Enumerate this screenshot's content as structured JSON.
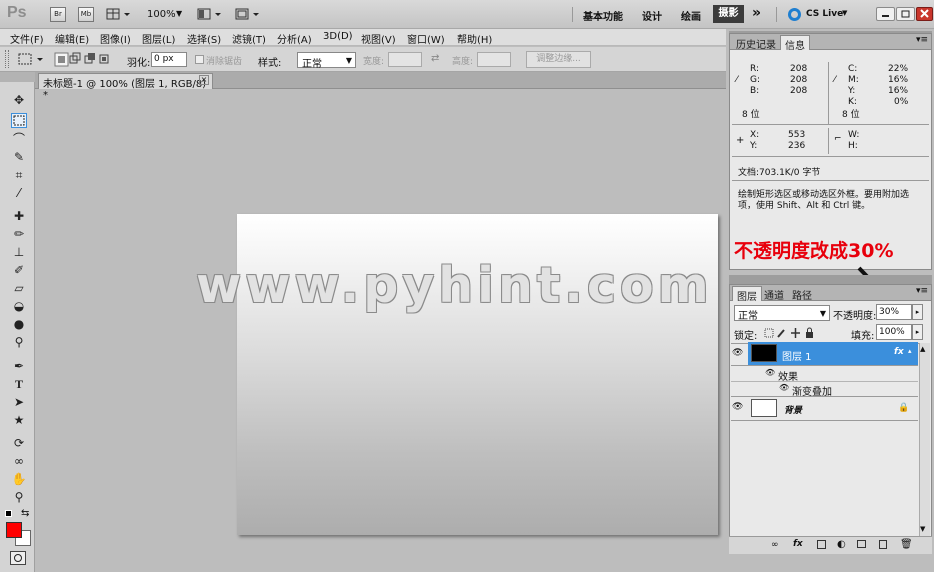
{
  "app": {
    "logo": "Ps",
    "bridge": "Br",
    "mini_bridge": "Mb",
    "zoom": "100%",
    "workspaces": [
      "基本功能",
      "设计",
      "绘画",
      "摄影"
    ],
    "more": "»",
    "cslive": "CS Live"
  },
  "menu": [
    "文件(F)",
    "编辑(E)",
    "图像(I)",
    "图层(L)",
    "选择(S)",
    "滤镜(T)",
    "分析(A)",
    "3D(D)",
    "视图(V)",
    "窗口(W)",
    "帮助(H)"
  ],
  "options": {
    "feather_label": "羽化:",
    "feather_value": "0 px",
    "antialias_label": "消除锯齿",
    "style_label": "样式:",
    "style_value": "正常",
    "width_label": "宽度:",
    "height_label": "高度:",
    "refine_edge": "调整边缘..."
  },
  "document": {
    "tab_title": "未标题-1 @ 100% (图层 1, RGB/8) *",
    "close": "×"
  },
  "watermark": "www.pyhint.com",
  "annotation": "不透明度改成30%",
  "info_panel": {
    "tabs": [
      "历史记录",
      "信息"
    ],
    "rgb": {
      "r_label": "R:",
      "r": "208",
      "g_label": "G:",
      "g": "208",
      "b_label": "B:",
      "b": "208",
      "bits": "8 位"
    },
    "cmyk": {
      "c_label": "C:",
      "c": "22%",
      "m_label": "M:",
      "m": "16%",
      "y_label": "Y:",
      "y": "16%",
      "k_label": "K:",
      "k": "0%",
      "bits": "8 位"
    },
    "xy": {
      "x_label": "X:",
      "x": "553",
      "y_label": "Y:",
      "y": "236"
    },
    "wh": {
      "w_label": "W:",
      "h_label": "H:"
    },
    "doc": "文档:703.1K/0 字节",
    "hint_line1": "绘制矩形选区或移动选区外框。要用附加选",
    "hint_line2": "项，使用 Shift、Alt 和 Ctrl 键。"
  },
  "layers_panel": {
    "tabs": [
      "图层",
      "通道",
      "路径"
    ],
    "blend_mode": "正常",
    "opacity_label": "不透明度:",
    "opacity_value": "30%",
    "lock_label": "锁定:",
    "fill_label": "填充:",
    "fill_value": "100%",
    "layer1": "图层 1",
    "effects": "效果",
    "gradient_overlay": "渐变叠加",
    "background": "背景",
    "fx": "fx"
  },
  "colors": {
    "foreground": "#ff0000",
    "background": "#ffffff",
    "selection": "#3b8fdc",
    "annotation": "#e8000c"
  }
}
